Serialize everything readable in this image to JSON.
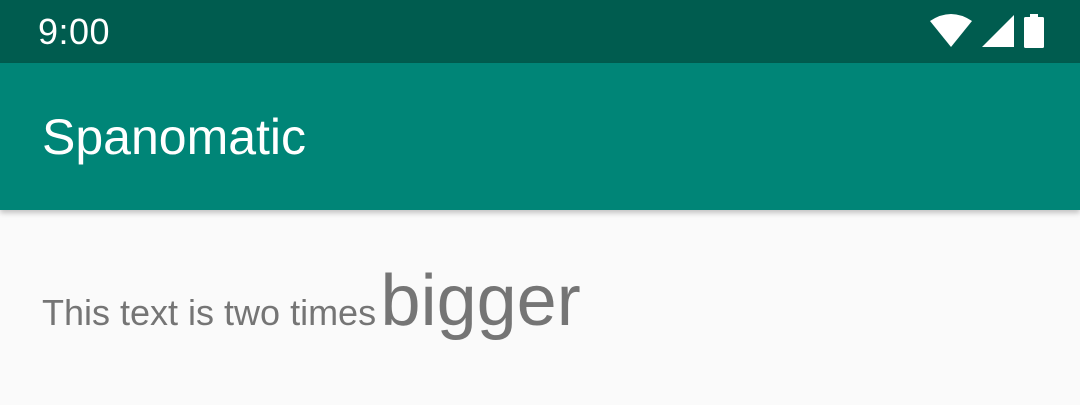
{
  "status_bar": {
    "time": "9:00",
    "icons": [
      "wifi-icon",
      "cellular-signal-icon",
      "battery-icon"
    ],
    "background": "#005c4f"
  },
  "app_bar": {
    "title": "Spanomatic",
    "background": "#008577"
  },
  "content": {
    "text_normal": "This text is two times",
    "text_big": "bigger",
    "text_color": "#757575",
    "background": "#fafafa"
  }
}
